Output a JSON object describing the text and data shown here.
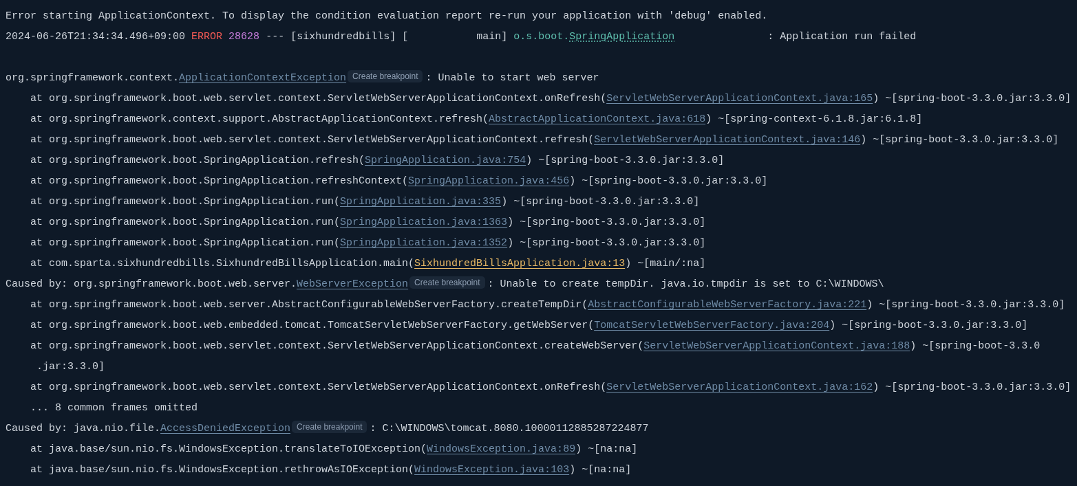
{
  "console": {
    "lines": [
      {
        "kind": "text",
        "text": "Error starting ApplicationContext. To display the condition evaluation report re-run your application with 'debug' enabled."
      },
      {
        "kind": "log",
        "timestamp": "2024-06-26T21:34:34.496+09:00",
        "level": "ERROR",
        "pid": "28628",
        "separator": "---",
        "app": "[sixhundredbills]",
        "thread": "[           main]",
        "logger_package": "o.s.boot.",
        "logger_class": "SpringApplication",
        "message": ": Application run failed"
      },
      {
        "kind": "blank"
      },
      {
        "kind": "exception",
        "prefix": "org.springframework.context.",
        "link": "ApplicationContextException",
        "badge": "Create breakpoint",
        "message": ": Unable to start web server"
      },
      {
        "kind": "frame",
        "text": "at org.springframework.boot.web.servlet.context.ServletWebServerApplicationContext.onRefresh(",
        "link": "ServletWebServerApplicationContext.java:165",
        "suffix": ") ~[spring-boot-3.3.0.jar:3.3.0]",
        "project_file": false
      },
      {
        "kind": "frame",
        "text": "at org.springframework.context.support.AbstractApplicationContext.refresh(",
        "link": "AbstractApplicationContext.java:618",
        "suffix": ") ~[spring-context-6.1.8.jar:6.1.8]",
        "project_file": false
      },
      {
        "kind": "frame",
        "text": "at org.springframework.boot.web.servlet.context.ServletWebServerApplicationContext.refresh(",
        "link": "ServletWebServerApplicationContext.java:146",
        "suffix": ") ~[spring-boot-3.3.0.jar:3.3.0]",
        "project_file": false
      },
      {
        "kind": "frame",
        "text": "at org.springframework.boot.SpringApplication.refresh(",
        "link": "SpringApplication.java:754",
        "suffix": ") ~[spring-boot-3.3.0.jar:3.3.0]",
        "project_file": false
      },
      {
        "kind": "frame",
        "text": "at org.springframework.boot.SpringApplication.refreshContext(",
        "link": "SpringApplication.java:456",
        "suffix": ") ~[spring-boot-3.3.0.jar:3.3.0]",
        "project_file": false
      },
      {
        "kind": "frame",
        "text": "at org.springframework.boot.SpringApplication.run(",
        "link": "SpringApplication.java:335",
        "suffix": ") ~[spring-boot-3.3.0.jar:3.3.0]",
        "project_file": false
      },
      {
        "kind": "frame",
        "text": "at org.springframework.boot.SpringApplication.run(",
        "link": "SpringApplication.java:1363",
        "suffix": ") ~[spring-boot-3.3.0.jar:3.3.0]",
        "project_file": false
      },
      {
        "kind": "frame",
        "text": "at org.springframework.boot.SpringApplication.run(",
        "link": "SpringApplication.java:1352",
        "suffix": ") ~[spring-boot-3.3.0.jar:3.3.0]",
        "project_file": false
      },
      {
        "kind": "frame",
        "text": "at com.sparta.sixhundredbills.SixhundredBillsApplication.main(",
        "link": "SixhundredBillsApplication.java:13",
        "suffix": ") ~[main/:na]",
        "project_file": true
      },
      {
        "kind": "exception",
        "prefix": "Caused by: org.springframework.boot.web.server.",
        "link": "WebServerException",
        "badge": "Create breakpoint",
        "message": ": Unable to create tempDir. java.io.tmpdir is set to C:\\WINDOWS\\"
      },
      {
        "kind": "frame",
        "text": "at org.springframework.boot.web.server.AbstractConfigurableWebServerFactory.createTempDir(",
        "link": "AbstractConfigurableWebServerFactory.java:221",
        "suffix": ") ~[spring-boot-3.3.0.jar:3.3.0]",
        "project_file": false
      },
      {
        "kind": "frame",
        "text": "at org.springframework.boot.web.embedded.tomcat.TomcatServletWebServerFactory.getWebServer(",
        "link": "TomcatServletWebServerFactory.java:204",
        "suffix": ") ~[spring-boot-3.3.0.jar:3.3.0]",
        "project_file": false
      },
      {
        "kind": "frame",
        "text": "at org.springframework.boot.web.servlet.context.ServletWebServerApplicationContext.createWebServer(",
        "link": "ServletWebServerApplicationContext.java:188",
        "suffix": ") ~[spring-boot-3.3.0",
        "project_file": false
      },
      {
        "kind": "continuation",
        "text": ".jar:3.3.0]"
      },
      {
        "kind": "frame",
        "text": "at org.springframework.boot.web.servlet.context.ServletWebServerApplicationContext.onRefresh(",
        "link": "ServletWebServerApplicationContext.java:162",
        "suffix": ") ~[spring-boot-3.3.0.jar:3.3.0]",
        "project_file": false
      },
      {
        "kind": "omitted",
        "text": "... 8 common frames omitted"
      },
      {
        "kind": "exception",
        "prefix": "Caused by: java.nio.file.",
        "link": "AccessDeniedException",
        "badge": "Create breakpoint",
        "message": ": C:\\WINDOWS\\tomcat.8080.10000112885287224877"
      },
      {
        "kind": "frame",
        "text": "at java.base/sun.nio.fs.WindowsException.translateToIOException(",
        "link": "WindowsException.java:89",
        "suffix": ") ~[na:na]",
        "project_file": false
      },
      {
        "kind": "frame",
        "text": "at java.base/sun.nio.fs.WindowsException.rethrowAsIOException(",
        "link": "WindowsException.java:103",
        "suffix": ") ~[na:na]",
        "project_file": false
      }
    ]
  }
}
